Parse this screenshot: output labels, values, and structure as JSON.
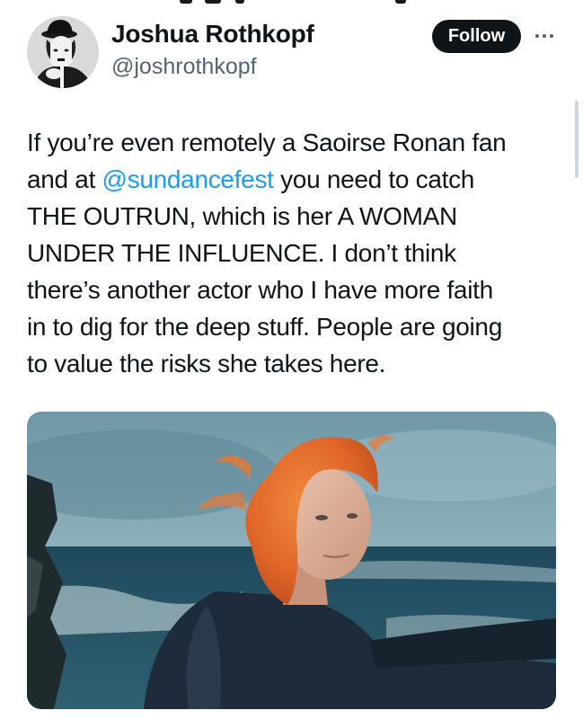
{
  "tweet": {
    "author": {
      "display_name": "Joshua Rothkopf",
      "handle": "@joshrothkopf"
    },
    "follow_label": "Follow",
    "more_icon": "more-horizontal-icon",
    "body": {
      "line1": "If you’re even remotely a Saoirse Ronan fan",
      "line2_prefix": "and at ",
      "line2_mention": "@sundancefest",
      "line2_suffix": " you need to catch",
      "line3": "THE OUTRUN, which is her A WOMAN",
      "line4": "UNDER THE INFLUENCE. I don’t think",
      "line5": "there’s another actor who I have more faith",
      "line6": "in to dig for the deep stuff. People are going",
      "line7": "to value the risks she takes here."
    },
    "colors": {
      "text": "#0f1419",
      "secondary": "#536471",
      "link": "#1d9bf0",
      "button_bg": "#0f1419",
      "button_text": "#ffffff"
    }
  }
}
